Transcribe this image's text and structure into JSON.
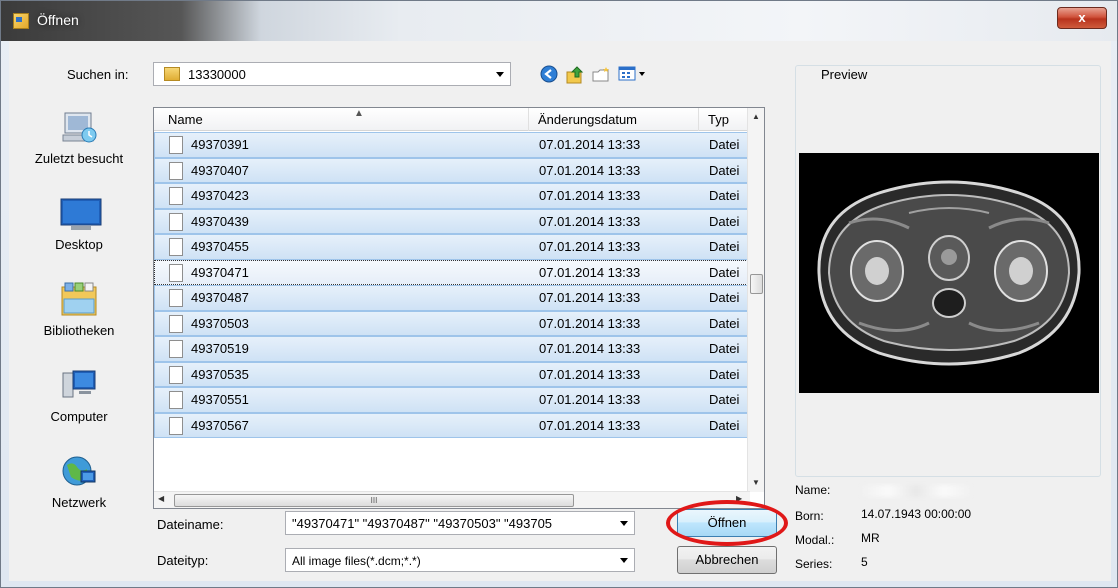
{
  "window": {
    "title": "Öffnen",
    "close_label": "x"
  },
  "toolbar": {
    "look_in_label": "Suchen in:",
    "look_in_value": "13330000",
    "icons": [
      "back-icon",
      "up-folder-icon",
      "new-folder-icon",
      "view-menu-icon"
    ]
  },
  "places": [
    {
      "label": "Zuletzt besucht",
      "icon": "recent-places-icon"
    },
    {
      "label": "Desktop",
      "icon": "desktop-icon"
    },
    {
      "label": "Bibliotheken",
      "icon": "libraries-icon"
    },
    {
      "label": "Computer",
      "icon": "computer-icon"
    },
    {
      "label": "Netzwerk",
      "icon": "network-icon"
    }
  ],
  "filelist": {
    "columns": {
      "name": "Name",
      "date": "Änderungsdatum",
      "type": "Typ"
    },
    "rows": [
      {
        "name": "49370391",
        "date": "07.01.2014 13:33",
        "type": "Datei"
      },
      {
        "name": "49370407",
        "date": "07.01.2014 13:33",
        "type": "Datei"
      },
      {
        "name": "49370423",
        "date": "07.01.2014 13:33",
        "type": "Datei"
      },
      {
        "name": "49370439",
        "date": "07.01.2014 13:33",
        "type": "Datei"
      },
      {
        "name": "49370455",
        "date": "07.01.2014 13:33",
        "type": "Datei"
      },
      {
        "name": "49370471",
        "date": "07.01.2014 13:33",
        "type": "Datei"
      },
      {
        "name": "49370487",
        "date": "07.01.2014 13:33",
        "type": "Datei"
      },
      {
        "name": "49370503",
        "date": "07.01.2014 13:33",
        "type": "Datei"
      },
      {
        "name": "49370519",
        "date": "07.01.2014 13:33",
        "type": "Datei"
      },
      {
        "name": "49370535",
        "date": "07.01.2014 13:33",
        "type": "Datei"
      },
      {
        "name": "49370551",
        "date": "07.01.2014 13:33",
        "type": "Datei"
      },
      {
        "name": "49370567",
        "date": "07.01.2014 13:33",
        "type": "Datei"
      }
    ],
    "focused_row_name": "49370471",
    "hscroll_grip": "III"
  },
  "form": {
    "filename_label": "Dateiname:",
    "filename_value": "\"49370471\" \"49370487\" \"49370503\" \"493705",
    "filetype_label": "Dateityp:",
    "filetype_value": "All image files(*.dcm;*.*)",
    "open_button": "Öffnen",
    "cancel_button": "Abbrechen"
  },
  "preview": {
    "title": "Preview",
    "info": {
      "name_label": "Name:",
      "born_label": "Born:",
      "born_value": "14.07.1943 00:00:00",
      "modality_label": "Modal.:",
      "modality_value": "MR",
      "series_label": "Series:",
      "series_value": "5"
    }
  },
  "colors": {
    "selection_fill": "#cfe2f5",
    "selection_border": "#9ec4ea",
    "highlight_circle": "#e01818"
  }
}
